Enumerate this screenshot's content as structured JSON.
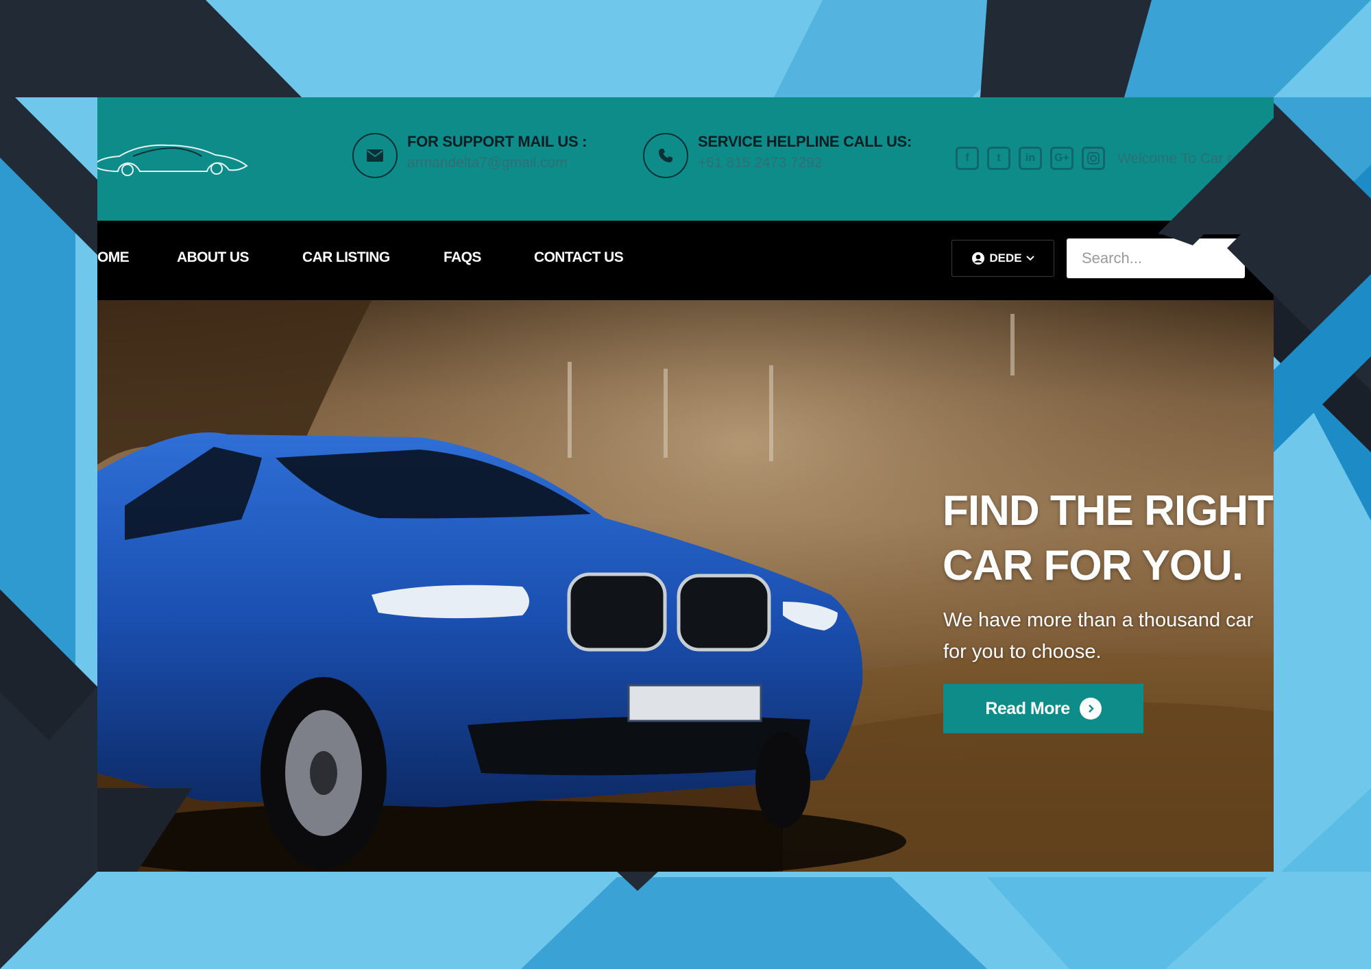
{
  "colors": {
    "accent": "#0e8c8a",
    "nav_bg": "#000000",
    "frame_dark": "#222a35",
    "frame_light": "#6fc8ec",
    "frame_mid": "#47a8d3"
  },
  "header": {
    "mail": {
      "icon": "envelope-icon",
      "title": "FOR SUPPORT MAIL US :",
      "value": "armandelta7@gmail.com"
    },
    "phone": {
      "icon": "phone-icon",
      "title": "SERVICE HELPLINE CALL US:",
      "value": "+61 815 2473 7292"
    },
    "social": [
      "facebook-icon",
      "twitter-icon",
      "linkedin-icon",
      "google-plus-icon",
      "instagram-icon"
    ],
    "welcome": "Welcome To Car r"
  },
  "nav": {
    "items": [
      "OME",
      "ABOUT US",
      "CAR LISTING",
      "FAQS",
      "CONTACT US"
    ],
    "user_label": "DEDE",
    "search_placeholder": "Search..."
  },
  "hero": {
    "headline_1": "FIND THE RIGHT",
    "headline_2": "CAR FOR YOU.",
    "subline_1": "We have more than a thousand car",
    "subline_2": "for you to choose.",
    "button_label": "Read More"
  }
}
